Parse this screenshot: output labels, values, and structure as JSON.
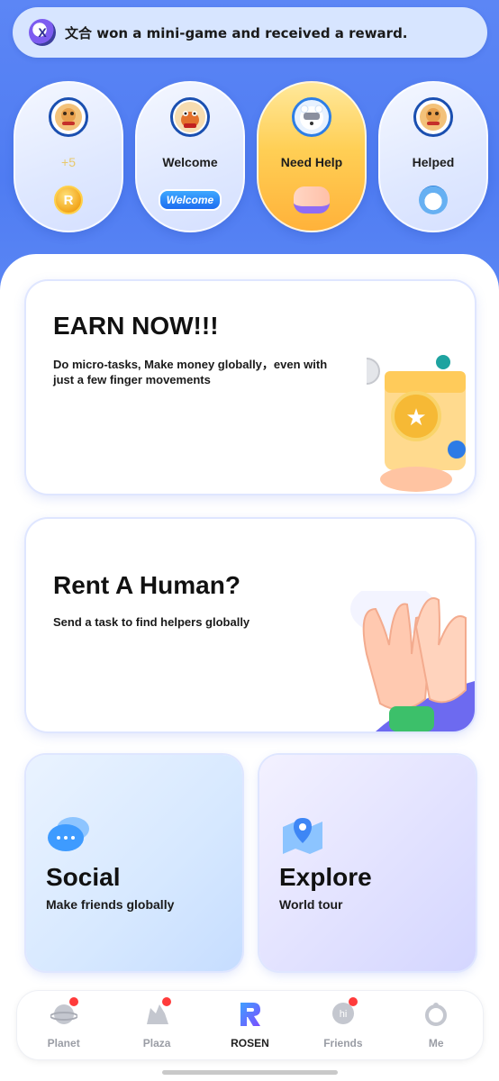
{
  "notification": {
    "text": "文合 won a mini-game and received a reward."
  },
  "pills": [
    {
      "label": "+5",
      "bottom": "coin",
      "coin_symbol": "R"
    },
    {
      "label": "Welcome",
      "bottom": "welcome-tag",
      "tag_text": "Welcome"
    },
    {
      "label": "Need Help",
      "bottom": "hands"
    },
    {
      "label": "Helped",
      "bottom": "bear"
    }
  ],
  "cards": {
    "earn": {
      "title": "EARN NOW!!!",
      "subtitle": "Do micro-tasks, Make money globally，even with just a few finger movements"
    },
    "rent": {
      "title": "Rent A Human?",
      "subtitle": "Send a task to find helpers globally"
    }
  },
  "tiles": {
    "social": {
      "title": "Social",
      "subtitle": "Make friends globally"
    },
    "explore": {
      "title": "Explore",
      "subtitle": "World tour"
    }
  },
  "nav": [
    {
      "label": "Planet",
      "icon": "planet-icon",
      "dot": true,
      "active": false
    },
    {
      "label": "Plaza",
      "icon": "plaza-icon",
      "dot": true,
      "active": false
    },
    {
      "label": "ROSEN",
      "icon": "rosen-logo-icon",
      "dot": false,
      "active": true
    },
    {
      "label": "Friends",
      "icon": "hi-bubble-icon",
      "dot": true,
      "active": false
    },
    {
      "label": "Me",
      "icon": "ring-icon",
      "dot": false,
      "active": false
    }
  ],
  "colors": {
    "header_blue": "#4f7cf2",
    "active_pill": "#ffcf55",
    "notification_dot": "#ff3b3b"
  }
}
